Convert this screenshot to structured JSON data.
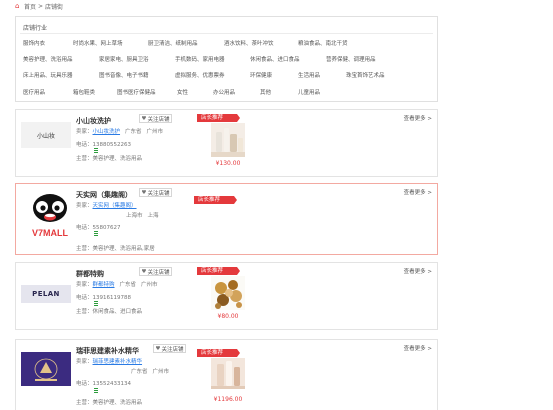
{
  "breadcrumb": {
    "home": "首页",
    "separator": ">",
    "current": "店铺街"
  },
  "category_panel": {
    "title": "店铺行业",
    "rows": [
      [
        "服饰内衣",
        "时尚水果、网上草场",
        "厨卫清洁、纸制用品",
        "酒水饮料、茶叶冲饮",
        "粮油食品、南北干货"
      ],
      [
        "美容护理、洗浴用品",
        "家居家电、厨具卫浴",
        "手机数码、家用电器",
        "休闲食品、进口食品",
        "营养保健、调理用品"
      ],
      [
        "床上用品、玩具乐器",
        "图书音像、电子书籍",
        "虚拟服务、优惠票券",
        "环保健康",
        "生活用品",
        "珠宝首饰艺术品"
      ],
      [
        "医疗用品",
        "箱包鞋类",
        "图书医疗保健品",
        "女性",
        "办公用品",
        "其他",
        "儿童用品"
      ]
    ]
  },
  "shops": [
    {
      "name": "小山妆洗护",
      "logo_text": "小山妆",
      "follow_label": "关注店铺",
      "seller_label": "卖家：",
      "seller_name": "小山妆洗护",
      "province": "广东省",
      "city": "广州市",
      "phone_label": "电话：",
      "phone": "13880552263",
      "main_label": "主营：",
      "main": "美容护理、洗浴用品",
      "badge": "店长推荐",
      "price": "¥130.00",
      "more": "查看更多 >"
    },
    {
      "name": "天实网（集趣阁）",
      "logo_text": "V7MALL",
      "follow_label": "关注店铺",
      "seller_label": "卖家：",
      "seller_name": "天实网（集趣阁）",
      "province": "上海市",
      "city": "上海",
      "phone_label": "电话：",
      "phone": "55807627",
      "main_label": "主营：",
      "main": "美容护理、洗浴用品,家居",
      "badge": "店长推荐",
      "price": "",
      "more": "查看更多 >"
    },
    {
      "name": "群都特购",
      "logo_text": "PELAN",
      "follow_label": "关注店铺",
      "seller_label": "卖家：",
      "seller_name": "群都特购",
      "province": "广东省",
      "city": "广州市",
      "phone_label": "电话：",
      "phone": "13916119788",
      "main_label": "主营：",
      "main": "休闲食品、进口食品",
      "badge": "店长推荐",
      "price": "¥80.00",
      "more": "查看更多 >"
    },
    {
      "name": "瑞菲思建素补水精华",
      "logo_text": "",
      "follow_label": "关注店铺",
      "seller_label": "卖家：",
      "seller_name": "瑞菲思建素补水精华",
      "province": "广东省",
      "city": "广州市",
      "phone_label": "电话：",
      "phone": "13552433134",
      "main_label": "主营：",
      "main": "美容护理、洗浴用品",
      "badge": "店长推荐",
      "price": "¥1196.00",
      "more": "查看更多 >"
    }
  ],
  "colors": {
    "accent": "#e4393c",
    "link": "#2a7be4",
    "qualification": "#2c9c3c"
  }
}
